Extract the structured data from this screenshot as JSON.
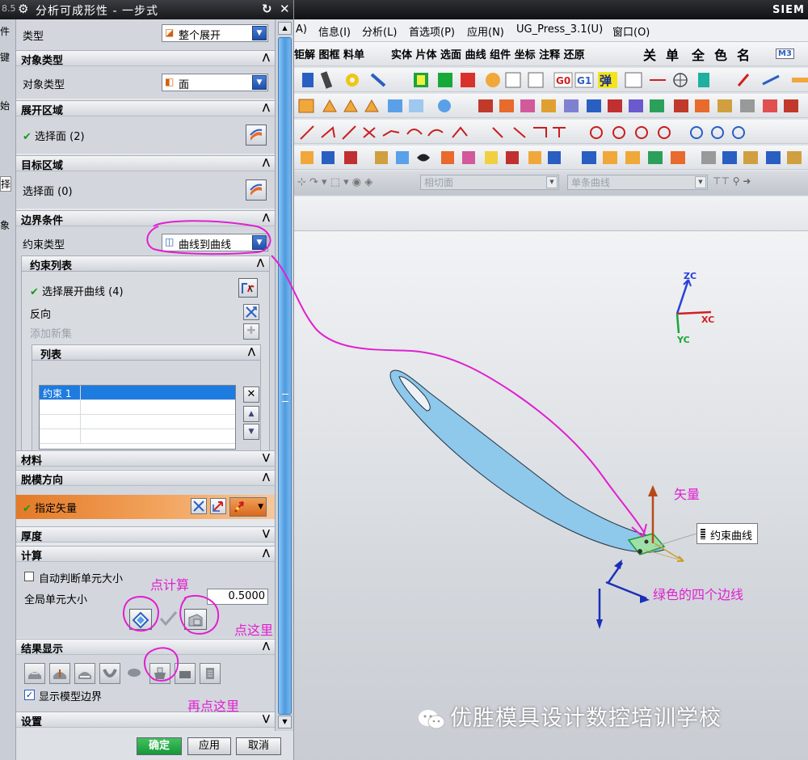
{
  "dialog": {
    "title": "分析可成形性 - 一步式",
    "title_left_fragment": "8.5",
    "left_strip": [
      "件",
      "键",
      "始",
      "择",
      "象"
    ],
    "type_label": "类型",
    "type_value": "整个展开",
    "sections": {
      "object_type": "对象类型",
      "unfold_region": "展开区域",
      "target_region": "目标区域",
      "boundary": "边界条件",
      "material": "材料",
      "draft_direction": "脱模方向",
      "thickness": "厚度",
      "compute": "计算",
      "result_display": "结果显示",
      "settings": "设置"
    },
    "object_type_label": "对象类型",
    "object_type_value": "面",
    "unfold_select": "选择面 (2)",
    "target_select": "选择面 (0)",
    "constraint_type_label": "约束类型",
    "constraint_type_value": "曲线到曲线",
    "constraint_list_title": "约束列表",
    "select_unfold_curve": "选择展开曲线 (4)",
    "reverse": "反向",
    "add_new_set": "添加新集",
    "list_title": "列表",
    "list_items": [
      "约束 1"
    ],
    "specify_vector": "指定矢量",
    "auto_element_size": "自动判断单元大小",
    "global_element_size_label": "全局单元大小",
    "global_element_size_value": "0.5000",
    "show_model_boundary": "显示模型边界",
    "ok": "确定",
    "apply": "应用",
    "cancel": "取消",
    "check_mark": "✔"
  },
  "main": {
    "brand": "SIEM",
    "menu": [
      "A)",
      "信息(I)",
      "分析(L)",
      "首选项(P)",
      "应用(N)",
      "UG_Press_3.1(U)",
      "窗口(O)"
    ],
    "toolbar_row1_a": "钜解 图框 料单",
    "toolbar_row1_b": "实体 片体 选面 曲线 组件 坐标 注释 还原",
    "toolbar_row1_chars": [
      "关",
      "单",
      "全",
      "色",
      "名"
    ],
    "toolbar_badges": [
      "M3",
      "G0",
      "G1",
      "弹"
    ],
    "filter_combo1": "相切面",
    "filter_combo2": "单条曲线"
  },
  "viewport": {
    "axis_labels": {
      "zc": "ZC",
      "xc": "XC",
      "yc": "YC"
    },
    "tooltip": "约束曲线"
  },
  "annotations": {
    "vector": "矢量",
    "green_edges": "绿色的四个边线",
    "click_compute": "点计算",
    "click_here": "点这里",
    "click_here_again": "再点这里"
  },
  "watermark": "优胜模具设计数控培训学校",
  "colors": {
    "annotation": "#e020d0",
    "vector_row": "#e37a28",
    "selection_blue": "#1e7be0",
    "part_fill": "#8ec8ea"
  }
}
